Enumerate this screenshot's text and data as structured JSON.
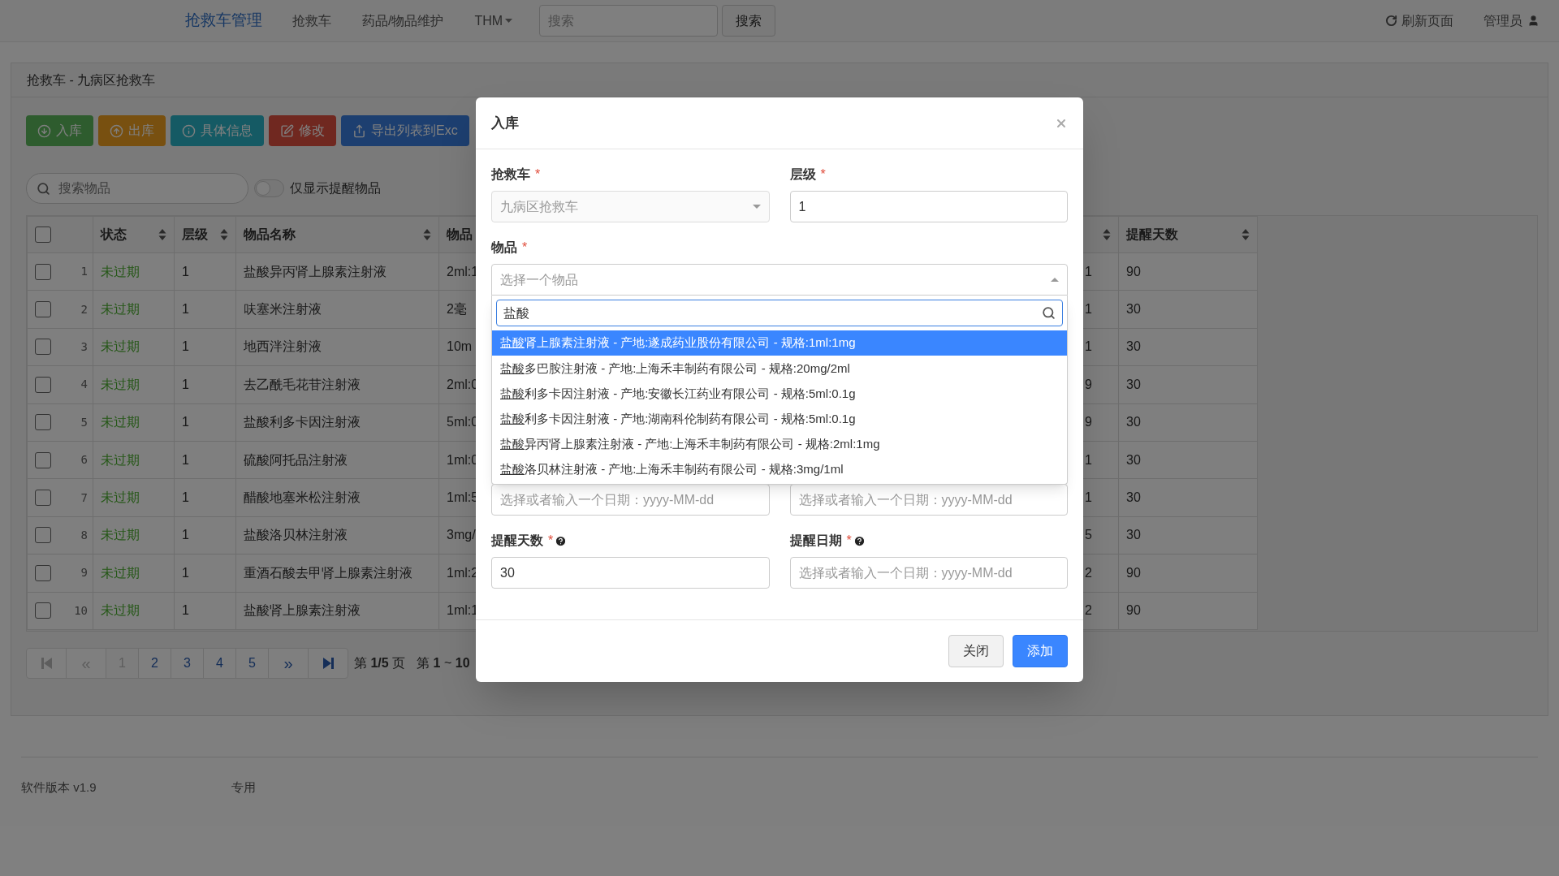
{
  "navbar": {
    "brand": "抢救车管理",
    "items": [
      {
        "label": "抢救车",
        "dropdown": false
      },
      {
        "label": "药品/物品维护",
        "dropdown": false
      },
      {
        "label": "THM",
        "dropdown": true
      }
    ],
    "search": {
      "placeholder": "搜索",
      "button": "搜索"
    },
    "refresh": "刷新页面",
    "user": "管理员"
  },
  "panel": {
    "title": "抢救车 - 九病区抢救车",
    "actions": [
      {
        "label": "入库",
        "kind": "in"
      },
      {
        "label": "出库",
        "kind": "out"
      },
      {
        "label": "具体信息",
        "kind": "info"
      },
      {
        "label": "修改",
        "kind": "edit"
      },
      {
        "label": "导出列表到Exc",
        "kind": "export"
      }
    ],
    "item_search": {
      "placeholder": "搜索物品"
    },
    "reminder_toggle": {
      "label": "仅显示提醒物品",
      "on": false
    },
    "table": {
      "select_all": {
        "checked": false
      },
      "columns": [
        {
          "label": "状态",
          "sortable": true
        },
        {
          "label": "层级",
          "sortable": true
        },
        {
          "label": "物品名称",
          "sortable": true
        },
        {
          "label": "物品"
        },
        {
          "sortable": true
        },
        {
          "label": "提醒天数",
          "sortable": true
        }
      ],
      "rows": [
        {
          "checked": false,
          "index": "1",
          "status": "未过期",
          "expired": false,
          "tier": "1",
          "name": "盐酸异丙肾上腺素注射液",
          "spec": "2ml:1",
          "column_6": "1",
          "remind_days": "90"
        },
        {
          "checked": false,
          "index": "2",
          "status": "未过期",
          "expired": false,
          "tier": "1",
          "name": "呋塞米注射液",
          "spec": "2毫",
          "column_6": "1",
          "remind_days": "30"
        },
        {
          "checked": false,
          "index": "3",
          "status": "未过期",
          "expired": false,
          "tier": "1",
          "name": "地西泮注射液",
          "spec": "10m",
          "column_6": "1",
          "remind_days": "30"
        },
        {
          "checked": false,
          "index": "4",
          "status": "未过期",
          "expired": false,
          "tier": "1",
          "name": "去乙酰毛花苷注射液",
          "spec": "2ml:0",
          "column_6": "9",
          "remind_days": "30"
        },
        {
          "checked": false,
          "index": "5",
          "status": "未过期",
          "expired": false,
          "tier": "1",
          "name": "盐酸利多卡因注射液",
          "spec": "5ml:0",
          "column_6": "9",
          "remind_days": "30"
        },
        {
          "checked": false,
          "index": "6",
          "status": "未过期",
          "expired": false,
          "tier": "1",
          "name": "硫酸阿托品注射液",
          "spec": "1ml:0",
          "column_6": "1",
          "remind_days": "30"
        },
        {
          "checked": false,
          "index": "7",
          "status": "未过期",
          "expired": false,
          "tier": "1",
          "name": "醋酸地塞米松注射液",
          "spec": "1ml:5",
          "column_6": "1",
          "remind_days": "30"
        },
        {
          "checked": false,
          "index": "8",
          "status": "未过期",
          "expired": false,
          "tier": "1",
          "name": "盐酸洛贝林注射液",
          "spec": "3mg/",
          "column_6": "5",
          "remind_days": "30"
        },
        {
          "checked": false,
          "index": "9",
          "status": "未过期",
          "expired": false,
          "tier": "1",
          "name": "重酒石酸去甲肾上腺素注射液",
          "spec": "1ml:2",
          "column_6": "2",
          "remind_days": "90"
        },
        {
          "checked": false,
          "index": "10",
          "status": "未过期",
          "expired": false,
          "tier": "1",
          "name": "盐酸肾上腺素注射液",
          "spec": "1ml:1",
          "column_6": "2",
          "remind_days": "90"
        }
      ]
    },
    "pagination": {
      "first": {
        "disabled": true
      },
      "prev": {
        "label": "«",
        "disabled": true
      },
      "pages": [
        {
          "label": "1",
          "selected": true
        },
        {
          "label": "2",
          "selected": false
        },
        {
          "label": "3",
          "selected": false
        },
        {
          "label": "4",
          "selected": false
        },
        {
          "label": "5",
          "selected": false
        }
      ],
      "next": {
        "label": "»",
        "disabled": false
      },
      "last": {
        "disabled": false
      },
      "page_info": "第 **1/5** 页",
      "range_info": "第 **1** ~ **10**"
    }
  },
  "footer": {
    "version": "软件版本 v1.9",
    "suffix": "专用"
  },
  "dialog": {
    "title": "入库",
    "top_fields": [
      {
        "kind": "select",
        "label": "抢救车",
        "required_mark": "*",
        "value": "九病区抢救车",
        "disabled": true
      },
      {
        "kind": "text",
        "label": "层级",
        "required_mark": "*",
        "value": "1",
        "disabled": false
      }
    ],
    "item_select": {
      "label": "物品",
      "required_mark": "*",
      "placeholder": "选择一个物品",
      "expanded": true,
      "search": "盐酸",
      "options": [
        {
          "match": "盐酸",
          "rest": "肾上腺素注射液 - 产地:遂成药业股份有限公司 - 规格:1ml:1mg",
          "selected": true
        },
        {
          "match": "盐酸",
          "rest": "多巴胺注射液 - 产地:上海禾丰制药有限公司 - 规格:20mg/2ml",
          "selected": false
        },
        {
          "match": "盐酸",
          "rest": "利多卡因注射液 - 产地:安徽长江药业有限公司 - 规格:5ml:0.1g",
          "selected": false
        },
        {
          "match": "盐酸",
          "rest": "利多卡因注射液 - 产地:湖南科伦制药有限公司 - 规格:5ml:0.1g",
          "selected": false
        },
        {
          "match": "盐酸",
          "rest": "异丙肾上腺素注射液 - 产地:上海禾丰制药有限公司 - 规格:2ml:1mg",
          "selected": false
        },
        {
          "match": "盐酸",
          "rest": "洛贝林注射液 - 产地:上海禾丰制药有限公司 - 规格:3mg/1ml",
          "selected": false
        }
      ]
    },
    "date_fields": [
      {
        "placeholder": "选择或者输入一个日期：yyyy-MM-dd"
      },
      {
        "placeholder": "选择或者输入一个日期：yyyy-MM-dd"
      }
    ],
    "reminder_fields": [
      {
        "label": "提醒天数",
        "required_mark": "*",
        "help": true,
        "value": "30"
      },
      {
        "label": "提醒日期",
        "required_mark": "*",
        "help": true,
        "placeholder": "选择或者输入一个日期：yyyy-MM-dd"
      }
    ],
    "buttons": [
      {
        "label": "关闭",
        "kind": "default"
      },
      {
        "label": "添加",
        "kind": "primary"
      }
    ]
  }
}
